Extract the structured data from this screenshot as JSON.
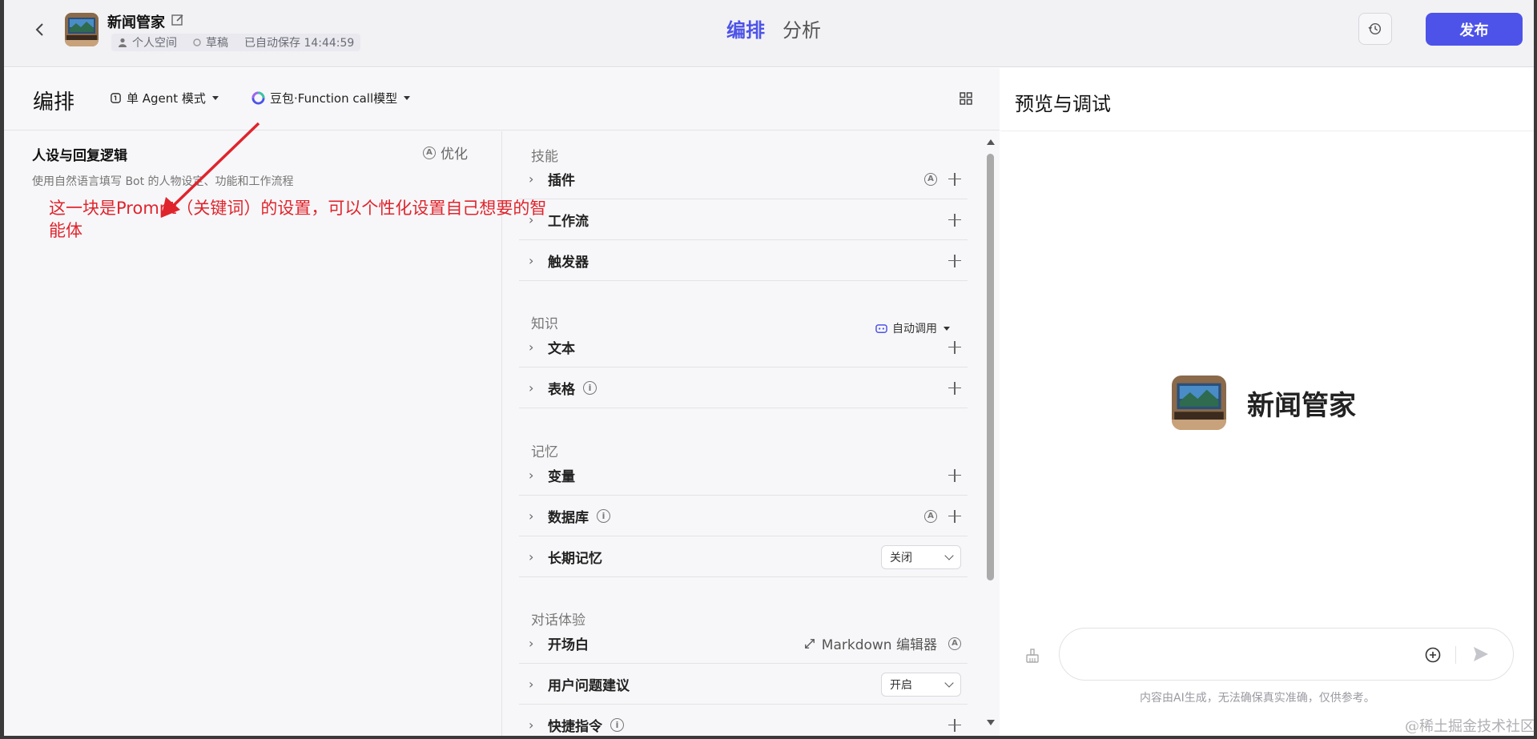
{
  "topbar": {
    "bot_name": "新闻管家",
    "space": "个人空间",
    "status": "草稿",
    "autosave": "已自动保存 14:44:59",
    "tabs": [
      {
        "label": "编排"
      },
      {
        "label": "分析"
      }
    ],
    "publish_label": "发布"
  },
  "editor": {
    "title": "编排",
    "mode": "单 Agent 模式",
    "model": "豆包·Function call模型"
  },
  "prompt": {
    "title": "人设与回复逻辑",
    "optimize_label": "优化",
    "placeholder": "使用自然语言填写 Bot 的人物设定、功能和工作流程",
    "annotation": "这一块是Prompt（关键词）的设置，可以个性化设置自己想要的智能体"
  },
  "skills": {
    "section_skills": "技能",
    "plugins": "插件",
    "workflow": "工作流",
    "trigger": "触发器",
    "section_knowledge": "知识",
    "auto_call": "自动调用",
    "text": "文本",
    "table": "表格",
    "section_memory": "记忆",
    "variables": "变量",
    "database": "数据库",
    "long_memory": "长期记忆",
    "long_memory_value": "关闭",
    "section_dialog": "对话体验",
    "opening": "开场白",
    "markdown_editor": "Markdown 编辑器",
    "suggestions": "用户问题建议",
    "suggestions_value": "开启",
    "shortcuts": "快捷指令"
  },
  "preview": {
    "title": "预览与调试",
    "bot_name": "新闻管家",
    "input_placeholder": "",
    "disclaimer": "内容由AI生成，无法确保真实准确，仅供参考。"
  },
  "watermark": "@稀土掘金技术社区",
  "colors": {
    "accent": "#4d53e8",
    "annotation": "#e0242c"
  }
}
